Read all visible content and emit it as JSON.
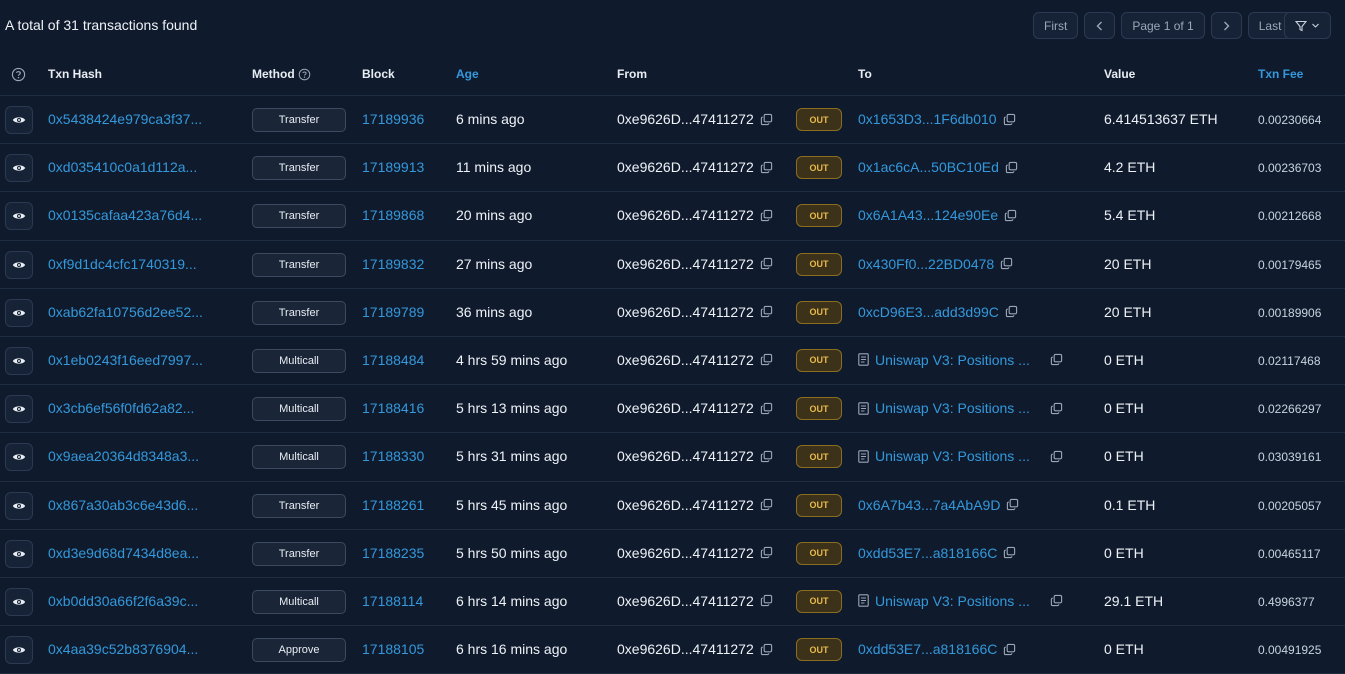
{
  "summary": "A total of 31 transactions found",
  "pagination": {
    "first": "First",
    "prev_icon": "chevron-left-icon",
    "page": "Page 1 of 1",
    "next_icon": "chevron-right-icon",
    "last": "Last",
    "filter_icon": "filter-icon"
  },
  "columns": {
    "txn_hash": "Txn Hash",
    "method": "Method",
    "block": "Block",
    "age": "Age",
    "from": "From",
    "to": "To",
    "value": "Value",
    "txn_fee": "Txn Fee"
  },
  "colors": {
    "background": "#0f1b2d",
    "link": "#3498db",
    "out_badge": "#e9b949"
  },
  "rows": [
    {
      "hash": "0x5438424e979ca3f37...",
      "method": "Transfer",
      "block": "17189936",
      "age": "6 mins ago",
      "from": "0xe9626D...47411272",
      "dir": "OUT",
      "to": "0x1653D3...1F6db010",
      "to_contract": false,
      "value": "6.414513637 ETH",
      "fee": "0.00230664"
    },
    {
      "hash": "0xd035410c0a1d112a...",
      "method": "Transfer",
      "block": "17189913",
      "age": "11 mins ago",
      "from": "0xe9626D...47411272",
      "dir": "OUT",
      "to": "0x1ac6cA...50BC10Ed",
      "to_contract": false,
      "value": "4.2 ETH",
      "fee": "0.00236703"
    },
    {
      "hash": "0x0135cafaa423a76d4...",
      "method": "Transfer",
      "block": "17189868",
      "age": "20 mins ago",
      "from": "0xe9626D...47411272",
      "dir": "OUT",
      "to": "0x6A1A43...124e90Ee",
      "to_contract": false,
      "value": "5.4 ETH",
      "fee": "0.00212668"
    },
    {
      "hash": "0xf9d1dc4cfc1740319...",
      "method": "Transfer",
      "block": "17189832",
      "age": "27 mins ago",
      "from": "0xe9626D...47411272",
      "dir": "OUT",
      "to": "0x430Ff0...22BD0478",
      "to_contract": false,
      "value": "20 ETH",
      "fee": "0.00179465"
    },
    {
      "hash": "0xab62fa10756d2ee52...",
      "method": "Transfer",
      "block": "17189789",
      "age": "36 mins ago",
      "from": "0xe9626D...47411272",
      "dir": "OUT",
      "to": "0xcD96E3...add3d99C",
      "to_contract": false,
      "value": "20 ETH",
      "fee": "0.00189906"
    },
    {
      "hash": "0x1eb0243f16eed7997...",
      "method": "Multicall",
      "block": "17188484",
      "age": "4 hrs 59 mins ago",
      "from": "0xe9626D...47411272",
      "dir": "OUT",
      "to": "Uniswap V3: Positions ...",
      "to_contract": true,
      "value": "0 ETH",
      "fee": "0.02117468"
    },
    {
      "hash": "0x3cb6ef56f0fd62a82...",
      "method": "Multicall",
      "block": "17188416",
      "age": "5 hrs 13 mins ago",
      "from": "0xe9626D...47411272",
      "dir": "OUT",
      "to": "Uniswap V3: Positions ...",
      "to_contract": true,
      "value": "0 ETH",
      "fee": "0.02266297"
    },
    {
      "hash": "0x9aea20364d8348a3...",
      "method": "Multicall",
      "block": "17188330",
      "age": "5 hrs 31 mins ago",
      "from": "0xe9626D...47411272",
      "dir": "OUT",
      "to": "Uniswap V3: Positions ...",
      "to_contract": true,
      "value": "0 ETH",
      "fee": "0.03039161"
    },
    {
      "hash": "0x867a30ab3c6e43d6...",
      "method": "Transfer",
      "block": "17188261",
      "age": "5 hrs 45 mins ago",
      "from": "0xe9626D...47411272",
      "dir": "OUT",
      "to": "0x6A7b43...7a4AbA9D",
      "to_contract": false,
      "value": "0.1 ETH",
      "fee": "0.00205057"
    },
    {
      "hash": "0xd3e9d68d7434d8ea...",
      "method": "Transfer",
      "block": "17188235",
      "age": "5 hrs 50 mins ago",
      "from": "0xe9626D...47411272",
      "dir": "OUT",
      "to": "0xdd53E7...a818166C",
      "to_contract": false,
      "value": "0 ETH",
      "fee": "0.00465117"
    },
    {
      "hash": "0xb0dd30a66f2f6a39c...",
      "method": "Multicall",
      "block": "17188114",
      "age": "6 hrs 14 mins ago",
      "from": "0xe9626D...47411272",
      "dir": "OUT",
      "to": "Uniswap V3: Positions ...",
      "to_contract": true,
      "value": "29.1 ETH",
      "fee": "0.4996377"
    },
    {
      "hash": "0x4aa39c52b8376904...",
      "method": "Approve",
      "block": "17188105",
      "age": "6 hrs 16 mins ago",
      "from": "0xe9626D...47411272",
      "dir": "OUT",
      "to": "0xdd53E7...a818166C",
      "to_contract": false,
      "value": "0 ETH",
      "fee": "0.00491925"
    }
  ]
}
